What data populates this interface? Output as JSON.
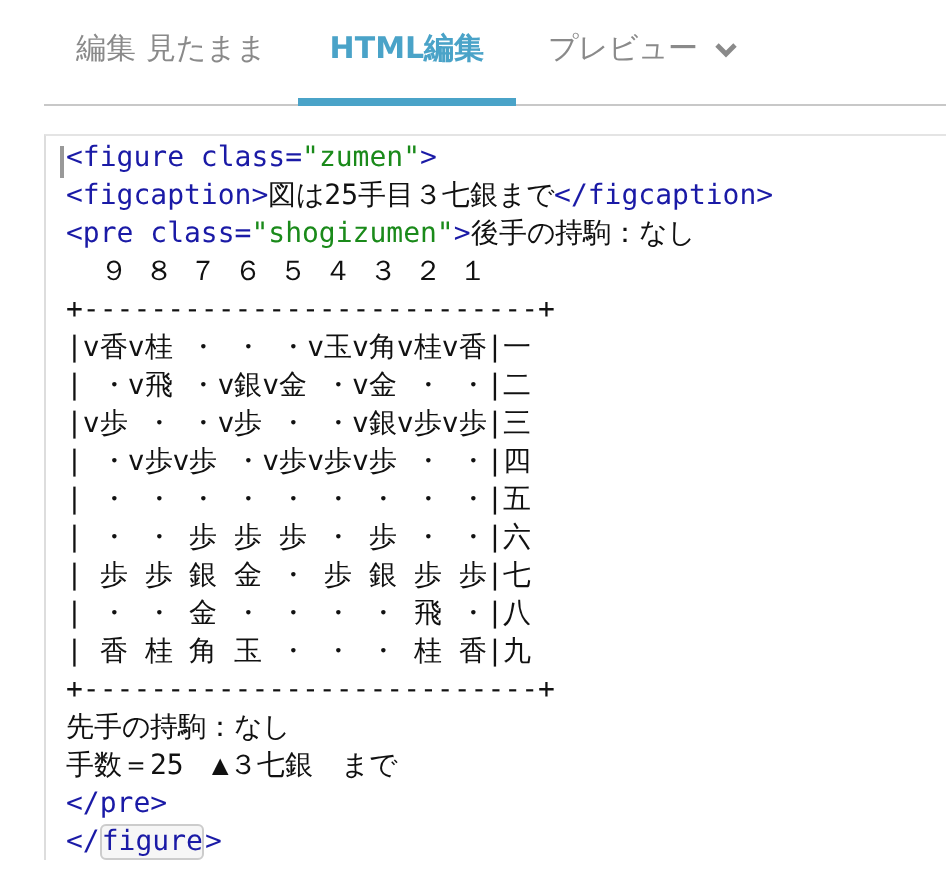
{
  "tabs": [
    {
      "label": "編集 見たまま",
      "selected": false,
      "dropdown": false
    },
    {
      "label": "HTML編集",
      "selected": true,
      "dropdown": false
    },
    {
      "label": "プレビュー",
      "selected": false,
      "dropdown": true
    }
  ],
  "editor": {
    "lines": [
      [
        {
          "kind": "tag",
          "text": "<figure class="
        },
        {
          "kind": "value",
          "text": "\"zumen\""
        },
        {
          "kind": "tag",
          "text": ">"
        }
      ],
      [
        {
          "kind": "tag",
          "text": "<figcaption>"
        },
        {
          "kind": "text",
          "text": "図は25手目３七銀まで"
        },
        {
          "kind": "tag",
          "text": "</figcaption>"
        }
      ],
      [
        {
          "kind": "tag",
          "text": "<pre class="
        },
        {
          "kind": "value",
          "text": "\"shogizumen\""
        },
        {
          "kind": "tag",
          "text": ">"
        },
        {
          "kind": "text",
          "text": "後手の持駒：なし"
        }
      ],
      [
        {
          "kind": "text",
          "text": "  ９ ８ ７ ６ ５ ４ ３ ２ １"
        }
      ],
      [
        {
          "kind": "text",
          "text": "+---------------------------+"
        }
      ],
      [
        {
          "kind": "text",
          "text": "|v香v桂 ・ ・ ・v玉v角v桂v香|一"
        }
      ],
      [
        {
          "kind": "text",
          "text": "| ・v飛 ・v銀v金 ・v金 ・ ・|二"
        }
      ],
      [
        {
          "kind": "text",
          "text": "|v歩 ・ ・v歩 ・ ・v銀v歩v歩|三"
        }
      ],
      [
        {
          "kind": "text",
          "text": "| ・v歩v歩 ・v歩v歩v歩 ・ ・|四"
        }
      ],
      [
        {
          "kind": "text",
          "text": "| ・ ・ ・ ・ ・ ・ ・ ・ ・|五"
        }
      ],
      [
        {
          "kind": "text",
          "text": "| ・ ・ 歩 歩 歩 ・ 歩 ・ ・|六"
        }
      ],
      [
        {
          "kind": "text",
          "text": "| 歩 歩 銀 金 ・ 歩 銀 歩 歩|七"
        }
      ],
      [
        {
          "kind": "text",
          "text": "| ・ ・ 金 ・ ・ ・ ・ 飛 ・|八"
        }
      ],
      [
        {
          "kind": "text",
          "text": "| 香 桂 角 玉 ・ ・ ・ 桂 香|九"
        }
      ],
      [
        {
          "kind": "text",
          "text": "+---------------------------+"
        }
      ],
      [
        {
          "kind": "text",
          "text": "先手の持駒：なし"
        }
      ],
      [
        {
          "kind": "text",
          "text": "手数＝25　▲３七銀　まで"
        }
      ],
      [
        {
          "kind": "tag",
          "text": "</pre>"
        }
      ],
      [
        {
          "kind": "tag",
          "text": "</"
        },
        {
          "kind": "match",
          "text": "figure"
        },
        {
          "kind": "tag",
          "text": ">"
        }
      ]
    ]
  }
}
